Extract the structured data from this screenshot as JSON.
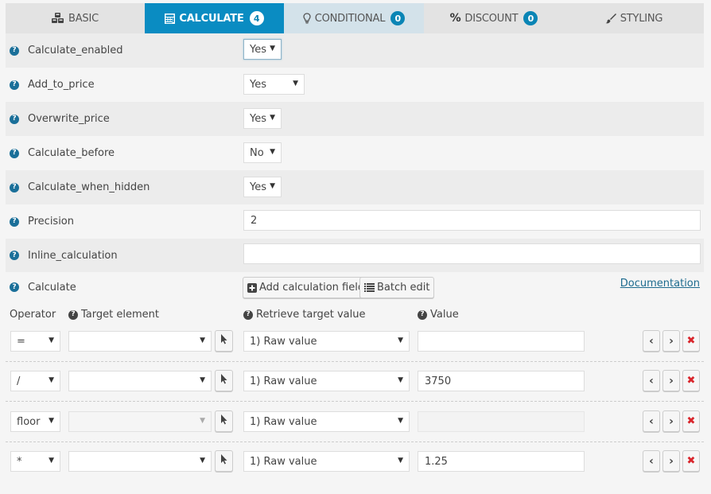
{
  "tabs": [
    {
      "label": "BASIC",
      "icon": "cubes-icon",
      "badge": null,
      "state": "default"
    },
    {
      "label": "CALCULATE",
      "icon": "calculator-icon",
      "badge": "4",
      "state": "active"
    },
    {
      "label": "CONDITIONAL",
      "icon": "lightbulb-icon",
      "badge": "0",
      "state": "hover"
    },
    {
      "label": "DISCOUNT",
      "icon": "percent-icon",
      "badge": "0",
      "state": "default"
    },
    {
      "label": "STYLING",
      "icon": "paintbrush-icon",
      "badge": null,
      "state": "default"
    }
  ],
  "settings": [
    {
      "label": "Calculate_enabled",
      "type": "select",
      "value": "Yes"
    },
    {
      "label": "Add_to_price",
      "type": "select",
      "value": "Yes"
    },
    {
      "label": "Overwrite_price",
      "type": "select",
      "value": "Yes"
    },
    {
      "label": "Calculate_before",
      "type": "select",
      "value": "No"
    },
    {
      "label": "Calculate_when_hidden",
      "type": "select",
      "value": "Yes"
    },
    {
      "label": "Precision",
      "type": "text",
      "value": "2"
    },
    {
      "label": "Inline_calculation",
      "type": "text",
      "value": ""
    },
    {
      "label": "Calculate",
      "type": "buttons"
    }
  ],
  "calculate_section": {
    "add_button": "Add calculation field",
    "batch_button": "Batch edit",
    "documentation_link": "Documentation"
  },
  "columns": {
    "operator": "Operator",
    "target_element": "Target element",
    "retrieve_target_value": "Retrieve target value",
    "value": "Value"
  },
  "calculations": [
    {
      "operator": "=",
      "target": "",
      "target_disabled": false,
      "retrieve": "1) Raw value",
      "value": "",
      "value_disabled": false
    },
    {
      "operator": "/",
      "target": "",
      "target_disabled": false,
      "retrieve": "1) Raw value",
      "value": "3750",
      "value_disabled": false
    },
    {
      "operator": "floor",
      "target": "",
      "target_disabled": true,
      "retrieve": "1) Raw value",
      "value": "",
      "value_disabled": true
    },
    {
      "operator": "*",
      "target": "",
      "target_disabled": false,
      "retrieve": "1) Raw value",
      "value": "1.25",
      "value_disabled": false
    }
  ],
  "colors": {
    "accent": "#0a8cc2",
    "badge": "#0a85b5",
    "help_icon": "#1a6f99",
    "delete": "#d9262c",
    "link": "#1d6b8e"
  }
}
